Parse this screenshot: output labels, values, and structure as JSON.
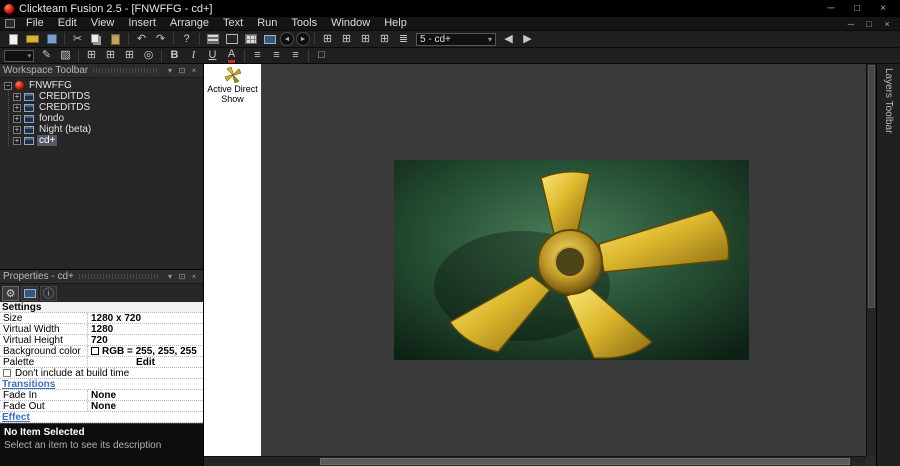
{
  "window": {
    "title": "Clickteam Fusion 2.5 - [FNWFFG - cd+]"
  },
  "glyphs": {
    "minimize": "─",
    "restore": "□",
    "close": "×",
    "dropdown": "▾",
    "pin": "⊡",
    "cut": "✂",
    "undo": "↶",
    "redo": "↷",
    "help": "?",
    "back": "◄",
    "forward": "►",
    "grid": "⊞",
    "layers": "≣",
    "pen": "✎",
    "fill": "▨",
    "zoom": "◎",
    "bold": "B",
    "italic": "I",
    "underline": "U",
    "fontcolor": "A",
    "align": "≡",
    "box": "□",
    "prev": "◀",
    "next": "▶",
    "gear": "⚙",
    "info": "ⓘ",
    "plus": "+",
    "minus": "−"
  },
  "menu": {
    "items": [
      "File",
      "Edit",
      "View",
      "Insert",
      "Arrange",
      "Text",
      "Run",
      "Tools",
      "Window",
      "Help"
    ]
  },
  "toolbar": {
    "frame_selector": "5 - cd+"
  },
  "workspace": {
    "title": "Workspace Toolbar",
    "tree": [
      {
        "label": "FNWFFG"
      },
      {
        "label": "CREDITDS"
      },
      {
        "label": "CREDITDS"
      },
      {
        "label": "fondo"
      },
      {
        "label": "Night (beta)"
      },
      {
        "label": "cd+"
      }
    ]
  },
  "properties": {
    "title": "Properties - cd+",
    "sections": {
      "settings": "Settings",
      "transitions": "Transitions",
      "effect": "Effect"
    },
    "fields": {
      "size": {
        "label": "Size",
        "value": "1280 x 720"
      },
      "virtual_width": {
        "label": "Virtual Width",
        "value": "1280"
      },
      "virtual_height": {
        "label": "Virtual Height",
        "value": "720"
      },
      "background_color": {
        "label": "Background color",
        "value": "RGB = 255, 255, 255"
      },
      "palette": {
        "label": "Palette",
        "value": "Edit"
      },
      "build_option": {
        "label": "Don't include at build time"
      },
      "fade_in": {
        "label": "Fade In",
        "value": "None"
      },
      "fade_out": {
        "label": "Fade Out",
        "value": "None"
      }
    },
    "description": {
      "title": "No Item Selected",
      "text": "Select an item to see its description"
    }
  },
  "editor": {
    "object_label": "Active Direct Show"
  },
  "layers_toolbar": {
    "title": "Layers Toolbar"
  },
  "colors": {
    "selection": "#515a64",
    "background_swatch": "#ffffff",
    "frame_bg_green": "#1e4a30",
    "blade_gold": "#e3c33a"
  }
}
